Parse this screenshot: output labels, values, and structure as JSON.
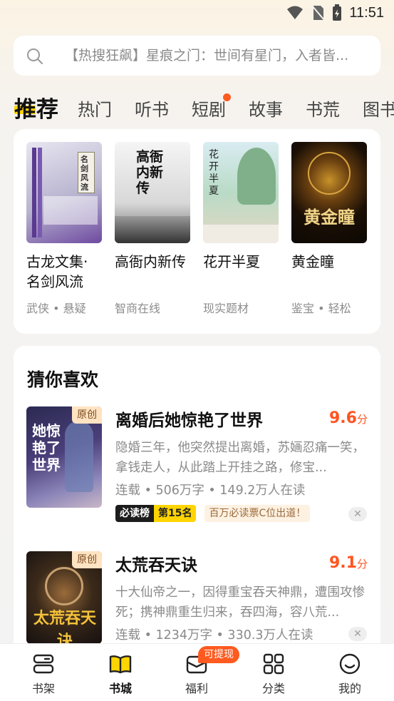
{
  "status_bar": {
    "time": "11:51"
  },
  "search": {
    "placeholder": "【热搜狂飙】星痕之门：世间有星门，入者皆..."
  },
  "tabs": [
    "推荐",
    "热门",
    "听书",
    "短剧",
    "故事",
    "书荒",
    "图书"
  ],
  "recommend": {
    "books": [
      {
        "title": "古龙文集·名剑风流",
        "sub": "武侠 • 悬疑",
        "cover_text": "名剑风流"
      },
      {
        "title": "高衙内新传",
        "sub": "智商在线",
        "cover_text": "高衙内新传"
      },
      {
        "title": "花开半夏",
        "sub": "现实题材",
        "cover_text": "花开半夏"
      },
      {
        "title": "黄金瞳",
        "sub": "鉴宝 • 轻松",
        "cover_text": "黄金瞳"
      }
    ]
  },
  "guess": {
    "heading": "猜你喜欢",
    "items": [
      {
        "title": "离婚后她惊艳了世界",
        "score": "9.6",
        "score_unit": "分",
        "badge": "原创",
        "desc": "隐婚三年，他突然提出离婚，苏婳忍痛一笑，拿钱走人，从此踏上开挂之路，修宝...",
        "meta": "连载 • 506万字 • 149.2万人在读",
        "rank_label": "必读榜",
        "rank_value": "第15名",
        "ticket": "百万必读票C位出道！",
        "cover_text": "她惊艳了世界"
      },
      {
        "title": "太荒吞天诀",
        "score": "9.1",
        "score_unit": "分",
        "badge": "原创",
        "desc": "十大仙帝之一，因得重宝吞天神鼎，遭围攻惨死；携神鼎重生归来，吞四海，容八荒...",
        "meta": "连载 • 1234万字 • 330.3万人在读",
        "cover_text": "太荒吞天诀"
      }
    ]
  },
  "bottom_nav": {
    "items": [
      {
        "label": "书架",
        "icon": "bookshelf-icon"
      },
      {
        "label": "书城",
        "icon": "book-open-icon"
      },
      {
        "label": "福利",
        "icon": "gift-icon"
      },
      {
        "label": "分类",
        "icon": "grid-icon"
      },
      {
        "label": "我的",
        "icon": "smile-icon"
      }
    ],
    "badge": "可提现"
  },
  "colors": {
    "accent": "#ffd400",
    "score": "#ff5420",
    "badge": "#ff5a1f"
  }
}
